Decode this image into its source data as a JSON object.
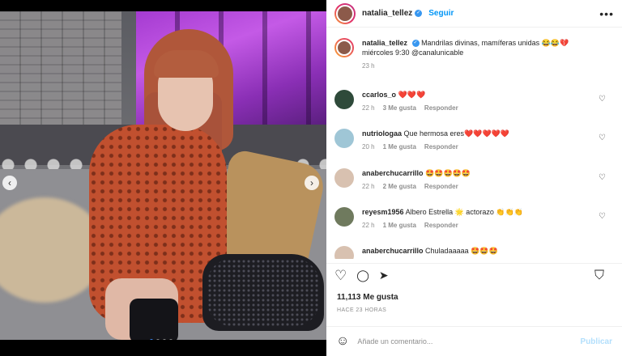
{
  "post": {
    "author": "natalia_tellez",
    "follow_label": "Seguir",
    "more_label": "•••",
    "caption": "Mandrilas divinas, mamíferas unidas 😂😂💔",
    "caption_second": "miércoles 9:30 @canalunicable",
    "caption_time": "23 h",
    "likes": "11,113 Me gusta",
    "posted": "HACE 23 HORAS",
    "carousel": {
      "total": 4,
      "active": 1
    }
  },
  "nav": {
    "prev": "‹",
    "next": "›"
  },
  "comments": [
    {
      "user": "ccarlos_o",
      "text": "❤️❤️❤️",
      "time": "22 h",
      "likes": "3 Me gusta",
      "reply": "Responder",
      "avatar_color": "#2e4a3a"
    },
    {
      "user": "nutriologaa",
      "text": "Que hermosa eres❤️❤️❤️❤️❤️",
      "time": "20 h",
      "likes": "1 Me gusta",
      "reply": "Responder",
      "avatar_color": "#9fc6d6"
    },
    {
      "user": "anaberchucarrillo",
      "text": "🤩🤩🤩🤩🤩",
      "time": "22 h",
      "likes": "2 Me gusta",
      "reply": "Responder",
      "avatar_color": "#d8c1b0"
    },
    {
      "user": "reyesm1956",
      "text": "Albero Estrella 🌟 actorazo 👏👏👏",
      "time": "22 h",
      "likes": "1 Me gusta",
      "reply": "Responder",
      "avatar_color": "#6f7a5e"
    },
    {
      "user": "anaberchucarrillo",
      "text": "Chuladaaaaa 🤩🤩🤩",
      "time": "",
      "likes": "",
      "reply": "",
      "avatar_color": "#d8c1b0"
    }
  ],
  "actions": {
    "like": "♡",
    "comment": "💬",
    "share": "➤",
    "save": "🔖"
  },
  "composer": {
    "emoji": "☺",
    "placeholder": "Añade un comentario...",
    "publish": "Publicar"
  },
  "colors": {
    "accent": "#0095f6",
    "muted": "#8e8e8e",
    "text": "#262626"
  }
}
